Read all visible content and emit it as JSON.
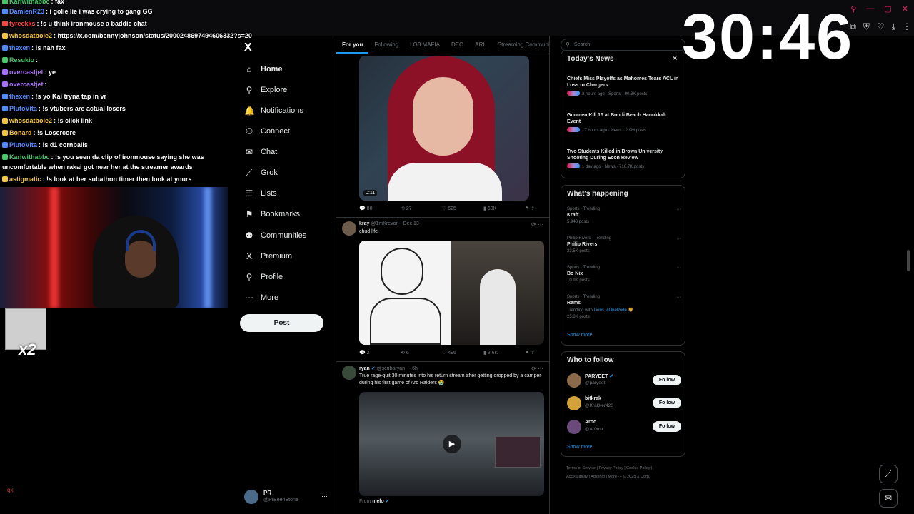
{
  "timer": "30:46",
  "chat": [
    {
      "user": "Kariwithabbc",
      "msg": "fax",
      "color": "#44c767"
    },
    {
      "user": "DamienR23",
      "msg": "i golie lie i was crying to gang GG",
      "color": "#4f8bff"
    },
    {
      "user": "tyreekks",
      "msg": "!s u think ironmouse a baddie chat",
      "color": "#ff4444"
    },
    {
      "user": "whosdatboie2",
      "msg": "https://x.com/bennyjohnson/status/2000248697494606332?s=20",
      "color": "#f5c542"
    },
    {
      "user": "thexen",
      "msg": "!s nah fax",
      "color": "#4f8bff"
    },
    {
      "user": "Resukio",
      "msg": "",
      "color": "#44c767"
    },
    {
      "user": "overcastjet",
      "msg": "ye",
      "color": "#a970ff"
    },
    {
      "user": "overcastjet",
      "msg": "",
      "color": "#a970ff"
    },
    {
      "user": "thexen",
      "msg": "!s yo Kai tryna tap in vr",
      "color": "#4f8bff"
    },
    {
      "user": "PlutoVita",
      "msg": "!s vtubers are actual losers",
      "color": "#4f8bff"
    },
    {
      "user": "whosdatboie2",
      "msg": "!s click link",
      "color": "#f5c542"
    },
    {
      "user": "Bonard",
      "msg": "!s Losercore",
      "color": "#f5c542"
    },
    {
      "user": "PlutoVita",
      "msg": "!s d1 cornballs",
      "color": "#4f8bff"
    },
    {
      "user": "Kariwithabbc",
      "msg": "!s you seen da clip of ironmouse saying she was",
      "color": "#44c767"
    },
    {
      "user": "",
      "msg": "uncomfortable when rakai got near her at the streamer awards",
      "color": "#ffffff"
    },
    {
      "user": "astigmatic",
      "msg": "!s look at her subathon timer then look at yours",
      "color": "#f5c542"
    }
  ],
  "baby_label": "x2",
  "corner_tag": "qx",
  "nav": {
    "logo": "X",
    "items": [
      {
        "label": "Home",
        "icon": "home-icon",
        "glyph": "⌂"
      },
      {
        "label": "Explore",
        "icon": "search-icon",
        "glyph": "⚲"
      },
      {
        "label": "Notifications",
        "icon": "bell-icon",
        "glyph": "🔔"
      },
      {
        "label": "Connect",
        "icon": "person-add-icon",
        "glyph": "⚇"
      },
      {
        "label": "Chat",
        "icon": "mail-icon",
        "glyph": "✉"
      },
      {
        "label": "Grok",
        "icon": "grok-icon",
        "glyph": "⟋"
      },
      {
        "label": "Lists",
        "icon": "list-icon",
        "glyph": "☰"
      },
      {
        "label": "Bookmarks",
        "icon": "bookmark-icon",
        "glyph": "⚑"
      },
      {
        "label": "Communities",
        "icon": "people-icon",
        "glyph": "⚉"
      },
      {
        "label": "Premium",
        "icon": "x-premium-icon",
        "glyph": "X"
      },
      {
        "label": "Profile",
        "icon": "user-icon",
        "glyph": "⚲"
      },
      {
        "label": "More",
        "icon": "more-circle-icon",
        "glyph": "⋯"
      }
    ],
    "post_label": "Post",
    "account_name": "PR",
    "account_handle": "@PrBeenStone"
  },
  "feed": {
    "tabs": [
      "For you",
      "Following",
      "LG3 MAFIA",
      "DEO",
      "ARL",
      "Streaming Community"
    ],
    "post1": {
      "duration": "0:11",
      "replies": "80",
      "reposts": "27",
      "likes": "625",
      "views": "60K"
    },
    "post2": {
      "name": "kray",
      "handle": "@1mKrevon",
      "date": "Dec 13",
      "text": "chud life",
      "replies": "2",
      "reposts": "6",
      "likes": "496",
      "views": "8.6K"
    },
    "post3": {
      "name": "ryan",
      "handle": "@scubaryan_",
      "date": "6h",
      "text": "True rage-quit 30 minutes into his return stream after getting dropped by a camper during his first game of Arc Raiders 😭",
      "from_label": "From",
      "from_user": "melo"
    }
  },
  "right": {
    "search_placeholder": "Search",
    "news_title": "Today's News",
    "news": [
      {
        "title": "Chiefs Miss Playoffs as Mahomes Tears ACL in Loss to Chargers",
        "meta": "3 hours ago · Sports · 90.3K posts"
      },
      {
        "title": "Gunmen Kill 15 at Bondi Beach Hanukkah Event",
        "meta": "17 hours ago · News · 2.9M posts"
      },
      {
        "title": "Two Students Killed in Brown University Shooting During Econ Review",
        "meta": "1 day ago · News · 716.7K posts"
      }
    ],
    "happening_title": "What's happening",
    "trends": [
      {
        "cat": "Sports · Trending",
        "name": "Kraft",
        "extra": "5,948 posts",
        "link": ""
      },
      {
        "cat": "Philip Rivers · Trending",
        "name": "Philip Rivers",
        "extra": "33.5K posts",
        "link": ""
      },
      {
        "cat": "Sports · Trending",
        "name": "Bo Nix",
        "extra": "10.9K posts",
        "link": ""
      },
      {
        "cat": "Sports · Trending",
        "name": "Rams",
        "extra": "Trending with",
        "link": "Lions, #OnePride 🦁",
        "posts": "25.8K posts"
      }
    ],
    "show_more": "Show more",
    "follow_title": "Who to follow",
    "follows": [
      {
        "name": "PARYEET",
        "handle": "@paryeet",
        "verified": true,
        "color": "#8a6a4a"
      },
      {
        "name": "bitkrak",
        "handle": "@Krakker420",
        "verified": false,
        "color": "#d4a23a"
      },
      {
        "name": "Aroc",
        "handle": "@Ar0nsr",
        "verified": false,
        "color": "#6a4a7a"
      }
    ],
    "follow_label": "Follow",
    "footer1": "Terms of Service  |  Privacy Policy  |  Cookie Policy  |",
    "footer2": "Accessibility  |  Ads info  |  More ···  © 2025 X Corp."
  }
}
